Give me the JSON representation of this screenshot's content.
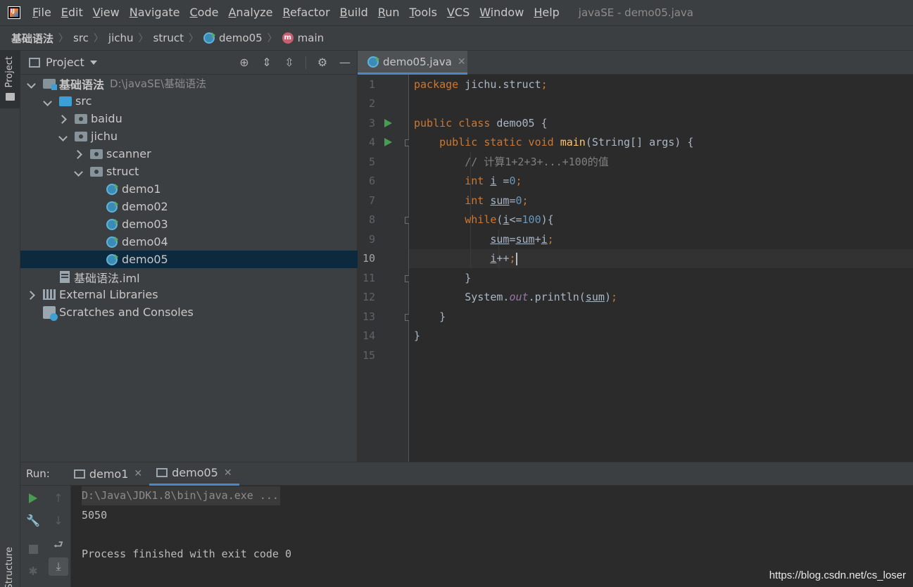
{
  "menubar": {
    "items": [
      "File",
      "Edit",
      "View",
      "Navigate",
      "Code",
      "Analyze",
      "Refactor",
      "Build",
      "Run",
      "Tools",
      "VCS",
      "Window",
      "Help"
    ],
    "window_title": "javaSE - demo05.java"
  },
  "breadcrumb": {
    "items": [
      "基础语法",
      "src",
      "jichu",
      "struct",
      "demo05",
      "main"
    ]
  },
  "left_stripe": {
    "project_label": "Project",
    "structure_label": "Structure"
  },
  "project_panel": {
    "title": "Project",
    "tree": [
      {
        "label": "基础语法",
        "path": "D:\\javaSE\\基础语法"
      },
      {
        "label": "src"
      },
      {
        "label": "baidu"
      },
      {
        "label": "jichu"
      },
      {
        "label": "scanner"
      },
      {
        "label": "struct"
      },
      {
        "label": "demo1"
      },
      {
        "label": "demo02"
      },
      {
        "label": "demo03"
      },
      {
        "label": "demo04"
      },
      {
        "label": "demo05"
      },
      {
        "label": "基础语法.iml"
      },
      {
        "label": "External Libraries"
      },
      {
        "label": "Scratches and Consoles"
      }
    ]
  },
  "editor": {
    "tab_label": "demo05.java",
    "line_numbers": [
      "1",
      "2",
      "3",
      "4",
      "5",
      "6",
      "7",
      "8",
      "9",
      "10",
      "11",
      "12",
      "13",
      "14",
      "15"
    ],
    "code": {
      "l1_kw": "package ",
      "l1_rest": "jichu.struct",
      "l1_semi": ";",
      "l3_kw": "public class ",
      "l3_rest": "demo05 {",
      "l4_kw": "public static void ",
      "l4_fn": "main",
      "l4_rest": "(String[] args) {",
      "l5_comment": "// 计算1+2+3+...+100的值",
      "l6_kw": "int ",
      "l6_var": "i",
      "l6_eq": " =",
      "l6_num": "0",
      "l6_semi": ";",
      "l7_kw": "int ",
      "l7_var": "sum",
      "l7_eq": "=",
      "l7_num": "0",
      "l7_semi": ";",
      "l8_kw": "while",
      "l8_open": "(",
      "l8_var": "i",
      "l8_op": "<=",
      "l8_num": "100",
      "l8_close": "){",
      "l9_var1": "sum",
      "l9_eq": "=",
      "l9_var2": "sum",
      "l9_plus": "+",
      "l9_var3": "i",
      "l9_semi": ";",
      "l10_var": "i",
      "l10_op": "++",
      "l10_semi": ";",
      "l11": "}",
      "l12_a": "System.",
      "l12_out": "out",
      "l12_b": ".println(",
      "l12_var": "sum",
      "l12_c": ")",
      "l12_semi": ";",
      "l13": "}",
      "l14": "}"
    }
  },
  "run_panel": {
    "label": "Run:",
    "tabs": [
      "demo1",
      "demo05"
    ],
    "console": {
      "command": "D:\\Java\\JDK1.8\\bin\\java.exe ...",
      "output": "5050",
      "exit": "Process finished with exit code 0"
    }
  },
  "watermark": "https://blog.csdn.net/cs_loser",
  "colors": {
    "keyword": "#cc7832",
    "function": "#ffc66d",
    "number": "#6897bb",
    "comment": "#808080",
    "static_field": "#9876aa",
    "selection": "#0d293e",
    "accent": "#4a88c7",
    "run_green": "#499c54"
  }
}
